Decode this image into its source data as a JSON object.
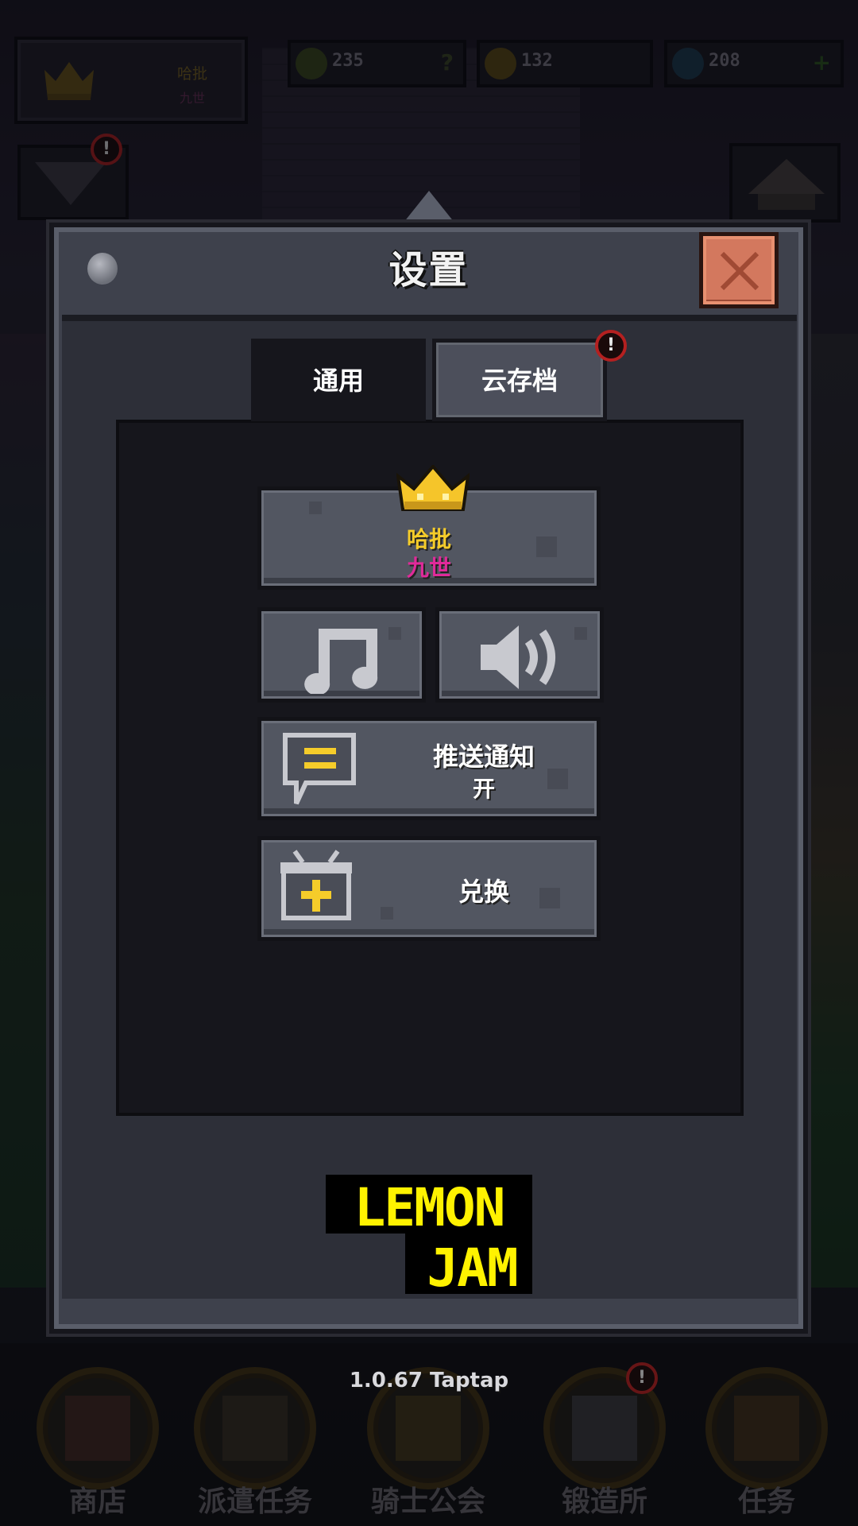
{
  "hud": {
    "player_name": "哈批",
    "player_title": "九世",
    "resources": [
      {
        "name": "trophy",
        "value": "235",
        "side": "?"
      },
      {
        "name": "coin",
        "value": "132",
        "side": ""
      },
      {
        "name": "gem",
        "value": "208",
        "side": "+"
      }
    ],
    "alert_mark": "!"
  },
  "dialog": {
    "title": "设置",
    "tabs": [
      {
        "label": "通用",
        "active": true
      },
      {
        "label": "云存档",
        "active": false,
        "alert": "!"
      }
    ],
    "profile": {
      "name": "哈批",
      "title": "九世"
    },
    "notification": {
      "label": "推送通知",
      "state": "开"
    },
    "redeem": {
      "label": "兑换"
    },
    "logo": {
      "line1": "LEMON",
      "line2": "JAM"
    }
  },
  "footer": {
    "version": "1.0.67 Taptap",
    "nav": [
      {
        "label": "商店",
        "alert": ""
      },
      {
        "label": "派遣任务",
        "alert": ""
      },
      {
        "label": "骑士公会",
        "alert": ""
      },
      {
        "label": "锻造所",
        "alert": "!"
      },
      {
        "label": "任务",
        "alert": ""
      }
    ]
  },
  "colors": {
    "accent_yellow": "#f5cc2a",
    "title_magenta": "#e02a9a",
    "close_orange": "#d3785e",
    "alert_red": "#b42020"
  }
}
